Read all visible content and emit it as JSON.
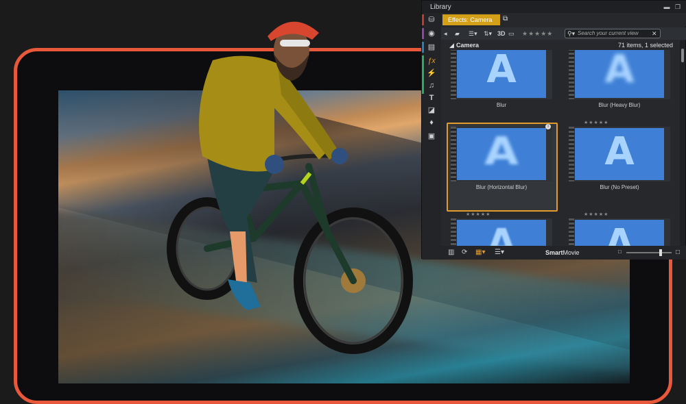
{
  "library": {
    "title": "Library",
    "tab_active": "Effects: Camera",
    "search_placeholder": "Search your current view",
    "toolbar": {
      "label_3d": "3D",
      "rating": "★★★★★"
    },
    "section": {
      "name": "Camera",
      "count": "71 items, 1 selected"
    },
    "items": [
      {
        "caption": "Blur",
        "stars": ""
      },
      {
        "caption": "Blur (Heavy Blur)",
        "stars": ""
      },
      {
        "caption": "Blur (Horizontal Blur)",
        "stars": ""
      },
      {
        "caption": "Blur (No Preset)",
        "stars": "★★★★★"
      },
      {
        "caption": "",
        "stars": "★★★★★"
      },
      {
        "caption": "",
        "stars": "★★★★★"
      }
    ],
    "thumb_letter": "A",
    "bottom": {
      "smart_movie_bold": "Smart",
      "smart_movie_rest": "Movie"
    }
  },
  "colors": {
    "accent_frame": "#e8583a",
    "tab_active": "#d4a017",
    "selection": "#e19a2c",
    "thumb_blue": "#3f80d6"
  }
}
